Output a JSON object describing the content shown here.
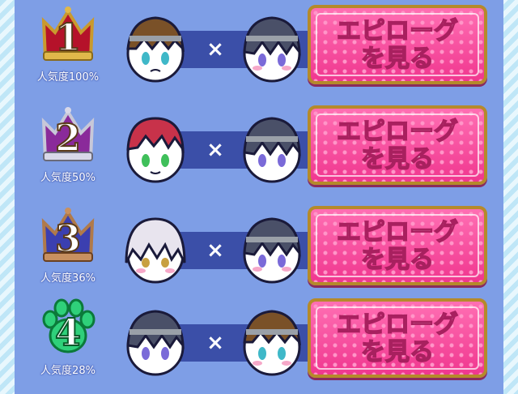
{
  "rows": [
    {
      "rank": "1",
      "rank_icon": "gold-crown-icon",
      "popularity": "人気度100%",
      "pair": [
        "brown-haired-boy-avatar",
        "dark-haired-boy-avatar"
      ],
      "separator": "×",
      "button_line1": "エピローグ",
      "button_line2": "を見る"
    },
    {
      "rank": "2",
      "rank_icon": "silver-crown-icon",
      "popularity": "人気度50%",
      "pair": [
        "red-haired-boy-avatar",
        "dark-haired-boy-avatar"
      ],
      "separator": "×",
      "button_line1": "エピローグ",
      "button_line2": "を見る"
    },
    {
      "rank": "3",
      "rank_icon": "bronze-crown-icon",
      "popularity": "人気度36%",
      "pair": [
        "white-haired-boy-avatar",
        "dark-haired-boy-avatar"
      ],
      "separator": "×",
      "button_line1": "エピローグ",
      "button_line2": "を見る"
    },
    {
      "rank": "4",
      "rank_icon": "green-paw-icon",
      "popularity": "人気度28%",
      "pair": [
        "dark-haired-boy-avatar",
        "brown-haired-boy-avatar"
      ],
      "separator": "×",
      "button_line1": "エピローグ",
      "button_line2": "を見る"
    }
  ],
  "colors": {
    "panel": "#7e9ee6",
    "bar": "#3b4fa8",
    "button": "#f0378f",
    "button_border": "#b58a2a",
    "gold": "#c99a2e",
    "silver": "#b8b8c8",
    "bronze": "#b07a4a",
    "paw": "#2fd07a"
  }
}
